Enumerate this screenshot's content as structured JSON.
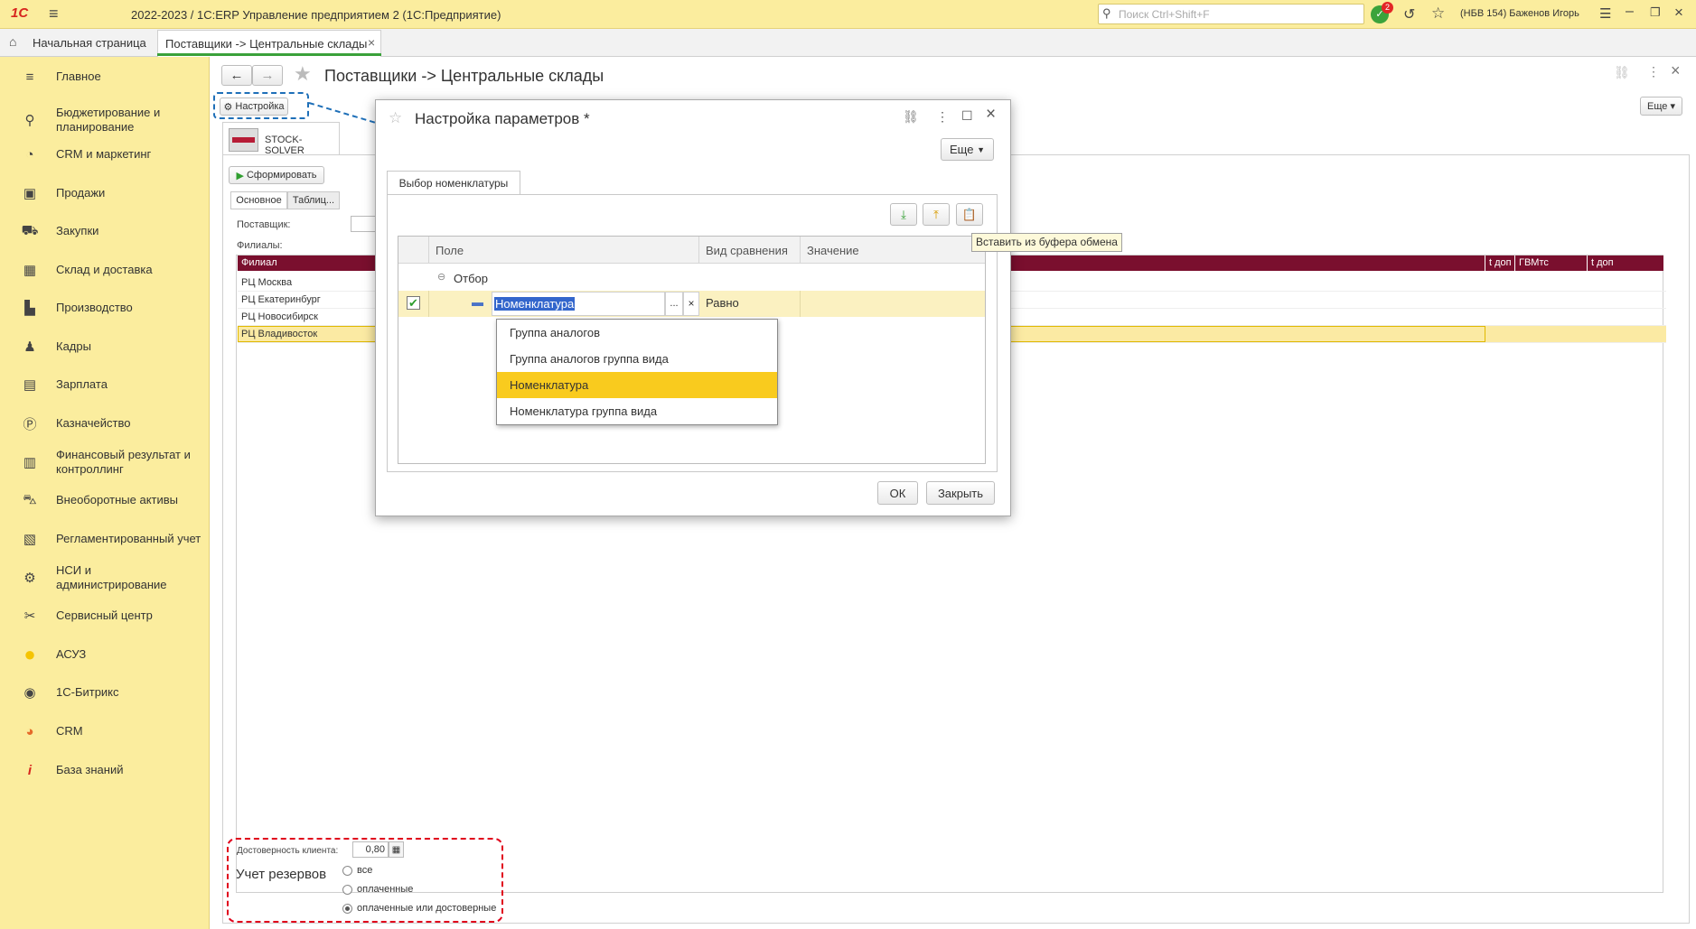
{
  "app": {
    "logo": "1С",
    "title": "2022-2023 / 1С:ERP Управление предприятием 2  (1С:Предприятие)",
    "search_placeholder": "Поиск Ctrl+Shift+F",
    "notifications_count": "2",
    "user": "(НБВ 154) Баженов Игорь"
  },
  "tabs": {
    "home": "Начальная страница",
    "active": "Поставщики -> Центральные склады",
    "close": "×"
  },
  "sidebar": {
    "items": [
      {
        "label": "Главное",
        "icon": "≡"
      },
      {
        "label": "Бюджетирование и планирование",
        "icon": "⚲"
      },
      {
        "label": "CRM и маркетинг",
        "icon": "◔"
      },
      {
        "label": "Продажи",
        "icon": "▣"
      },
      {
        "label": "Закупки",
        "icon": "⛟"
      },
      {
        "label": "Склад и доставка",
        "icon": "▦"
      },
      {
        "label": "Производство",
        "icon": "▙"
      },
      {
        "label": "Кадры",
        "icon": "♟"
      },
      {
        "label": "Зарплата",
        "icon": "▤"
      },
      {
        "label": "Казначейство",
        "icon": "Ⓟ"
      },
      {
        "label": "Финансовый результат и контроллинг",
        "icon": "▥"
      },
      {
        "label": "Внеоборотные активы",
        "icon": "⛍"
      },
      {
        "label": "Регламентированный учет",
        "icon": "▧"
      },
      {
        "label": "НСИ и администрирование",
        "icon": "⚙"
      },
      {
        "label": "Сервисный центр",
        "icon": "✂"
      },
      {
        "label": "АСУЗ",
        "icon": "●"
      },
      {
        "label": "1С-Битрикс",
        "icon": "◉"
      },
      {
        "label": "CRM",
        "icon": "◕"
      },
      {
        "label": "База знаний",
        "icon": "i"
      }
    ]
  },
  "form": {
    "title": "Поставщики -> Центральные склады",
    "settings_button": "Настройка",
    "more_button": "Еще",
    "logo_text": "STOCK-SOLVER",
    "generate_button": "Сформировать",
    "tab_main": "Основное",
    "tab_tables": "Таблиц...",
    "supplier_label": "Поставщик:",
    "branches_label": "Филиалы:",
    "table_headers": {
      "branch": "Филиал",
      "col_a": "t доп",
      "col_b": "ГВМтс",
      "col_c": "t доп расчётное"
    },
    "rows": [
      "РЦ Москва",
      "РЦ Екатеринбург",
      "РЦ Новосибирск",
      "РЦ Владивосток"
    ],
    "reliability_label": "Достоверность клиента:",
    "reliability_value": "0,80",
    "reserves_label": "Учет резервов",
    "radio_options": [
      "все",
      "оплаченные",
      "оплаченные или достоверные"
    ],
    "radio_selected_index": 2
  },
  "dialog": {
    "title": "Настройка параметров *",
    "more_button": "Еще",
    "tab": "Выбор номенклатуры",
    "tooltip": "Вставить из буфера обмена",
    "columns": {
      "field": "Поле",
      "comparison": "Вид сравнения",
      "value": "Значение"
    },
    "group_row": "Отбор",
    "filter_row": {
      "field": "Номенклатура",
      "comparison": "Равно",
      "select_btn": "...",
      "clear_btn": "×",
      "checked": true
    },
    "dropdown": [
      "Группа аналогов",
      "Группа аналогов группа вида",
      "Номенклатура",
      "Номенклатура группа вида"
    ],
    "dropdown_selected_index": 2,
    "ok_button": "ОК",
    "close_button": "Закрыть"
  },
  "colors": {
    "sidebar_bg": "#fbed9e",
    "accent_yellow": "#f9cb1e",
    "table_header": "#7a0f2e",
    "selection_blue": "#3366cc",
    "annotation_red": "#e0001b",
    "annotation_blue": "#1e6fb8"
  }
}
